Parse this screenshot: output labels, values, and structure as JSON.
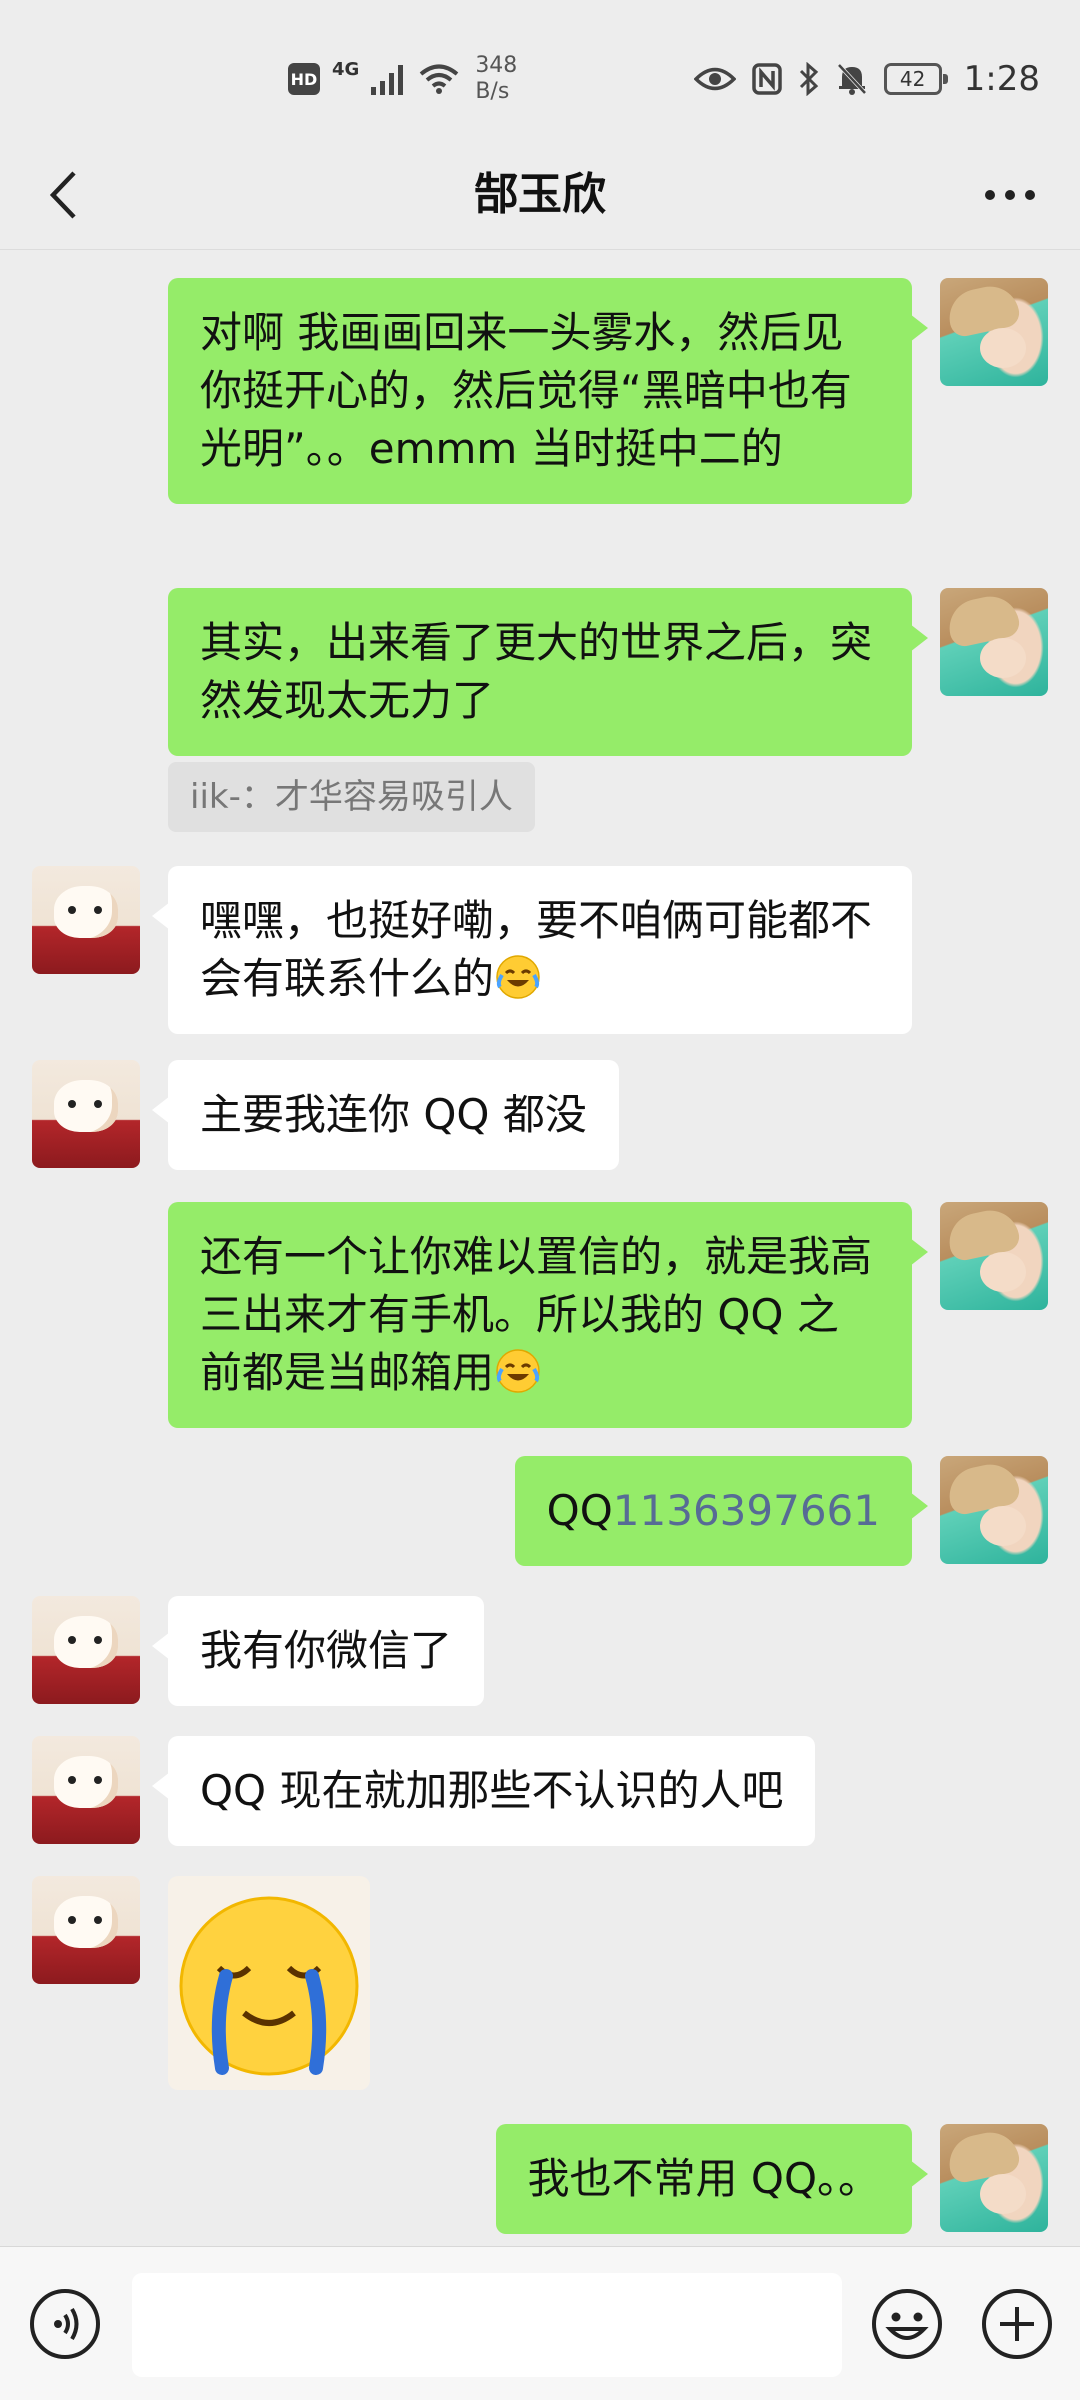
{
  "status_bar": {
    "hd": "HD",
    "network": "4G",
    "speed_value": "348",
    "speed_unit": "B/s",
    "battery": "42",
    "time": "1:28"
  },
  "header": {
    "title": "郜玉欣",
    "back_icon": "chevron-left-icon",
    "more_icon": "more-dots-icon"
  },
  "messages": [
    {
      "sender": "me",
      "text": "对啊 我画画回来一头雾水，然后见你挺开心的，然后觉得“黑暗中也有光明”。。emmm 当时挺中二的"
    },
    {
      "sender": "me",
      "text": "其实，出来看了更大的世界之后，突然发现太无力了"
    },
    {
      "sender": "quote",
      "text": "iik-：才华容易吸引人"
    },
    {
      "sender": "other",
      "text": "嘿嘿，也挺好嘞，要不咱俩可能都不会有联系什么的"
    },
    {
      "sender": "other",
      "text": "主要我连你 QQ 都没"
    },
    {
      "sender": "me",
      "text": "还有一个让你难以置信的，就是我高三出来才有手机。所以我的 QQ 之前都是当邮箱用"
    },
    {
      "sender": "me",
      "prefix": "QQ",
      "number": "1136397661"
    },
    {
      "sender": "other",
      "text": "我有你微信了"
    },
    {
      "sender": "other",
      "text": "QQ 现在就加那些不认识的人吧"
    },
    {
      "sender": "other",
      "sticker": "crying-smile-sticker"
    },
    {
      "sender": "me",
      "text": "我也不常用 QQ。。"
    }
  ],
  "input_bar": {
    "voice_icon": "voice-icon",
    "emoji_icon": "emoji-icon",
    "plus_icon": "plus-icon",
    "placeholder": ""
  },
  "colors": {
    "background": "#ededed",
    "bubble_me": "#95ec69",
    "bubble_other": "#ffffff",
    "link": "#576b95"
  }
}
